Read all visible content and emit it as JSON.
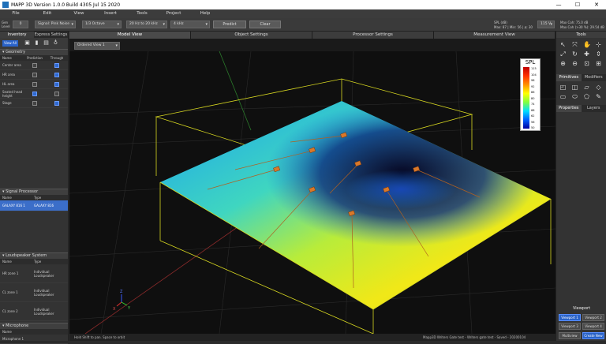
{
  "window": {
    "title": "MAPP 3D Version 1.0.0 Build 4305 Jul 15 2020",
    "min": "—",
    "max": "☐",
    "close": "✕"
  },
  "menu": [
    "File",
    "Edit",
    "View",
    "Insert",
    "Tools",
    "Project",
    "Help"
  ],
  "toolbar": {
    "gen_label": "Gen Level",
    "gen_value": "0",
    "signal": "Signal: Pink Noise",
    "avg": "1/3 Octave",
    "range": "20 Hz to 20 kHz",
    "freq": "4 kHz",
    "predict": "Predict",
    "clear": "Clear",
    "spl_info": "SPL (dB)",
    "minmax": "Max: 87 | Min: 56 | ∆: 30",
    "level": "115 V",
    "maxcoh": "Max Coh: 75.0 dB",
    "maxcoh2": "Max Coh (>30 %): 29.54 dB"
  },
  "left": {
    "tabs": [
      "Inventory",
      "Express Settings"
    ],
    "view_all": "View All",
    "geometry": {
      "title": "Geometry",
      "headers": [
        "Name",
        "Prediction",
        "Through"
      ],
      "rows": [
        {
          "name": "Center area",
          "pred": false,
          "thr": true
        },
        {
          "name": "HR area",
          "pred": false,
          "thr": true
        },
        {
          "name": "HL area",
          "pred": false,
          "thr": true
        },
        {
          "name": "Seated head height",
          "pred": true,
          "thr": false
        },
        {
          "name": "Stage",
          "pred": false,
          "thr": true
        }
      ]
    },
    "signal_processor": {
      "title": "Signal Processor",
      "headers": [
        "Name",
        "Type"
      ],
      "rows": [
        {
          "name": "GALAXY 816 1",
          "type": "GALAXY 816"
        }
      ]
    },
    "loudspeaker": {
      "title": "Loudspeaker System",
      "headers": [
        "Name",
        "Type"
      ],
      "rows": [
        {
          "name": "HR zone 1",
          "type": "Individual Loudspeaker"
        },
        {
          "name": "CL zone 1",
          "type": "Individual Loudspeaker"
        },
        {
          "name": "CL zone 2",
          "type": "Individual Loudspeaker"
        }
      ]
    },
    "microphone": {
      "title": "Microphone",
      "headers": [
        "Name"
      ],
      "rows": [
        {
          "name": "Microphone 1"
        }
      ]
    }
  },
  "tabs": [
    "Model View",
    "Object Settings",
    "Processor Settings",
    "Measurement View"
  ],
  "view_select": "Ordered View 1",
  "legend": {
    "title": "SPL",
    "ticks": [
      "115",
      "104",
      "98",
      "92",
      "86",
      "80",
      "74",
      "68",
      "62",
      "56",
      "50"
    ]
  },
  "status": {
    "left": "Hold Shift to pan. Space to orbit",
    "right": "Mapp3D Writers Gate test - Writers gate test - Saved - 20200104"
  },
  "right": {
    "tools": "Tools",
    "tabs1": [
      "Primitives",
      "Modifiers"
    ],
    "tabs2": [
      "Properties",
      "Layers"
    ],
    "viewport": "Viewport",
    "vp_buttons": [
      "Viewport 1",
      "Viewport 2",
      "Viewport 3",
      "Viewport 4"
    ],
    "multiview": "Multiview",
    "create": "Create New"
  },
  "axes": {
    "x": "X",
    "y": "Y",
    "z": "Z"
  },
  "colors": {
    "accent": "#2a63c9",
    "box": "#d8d820"
  }
}
